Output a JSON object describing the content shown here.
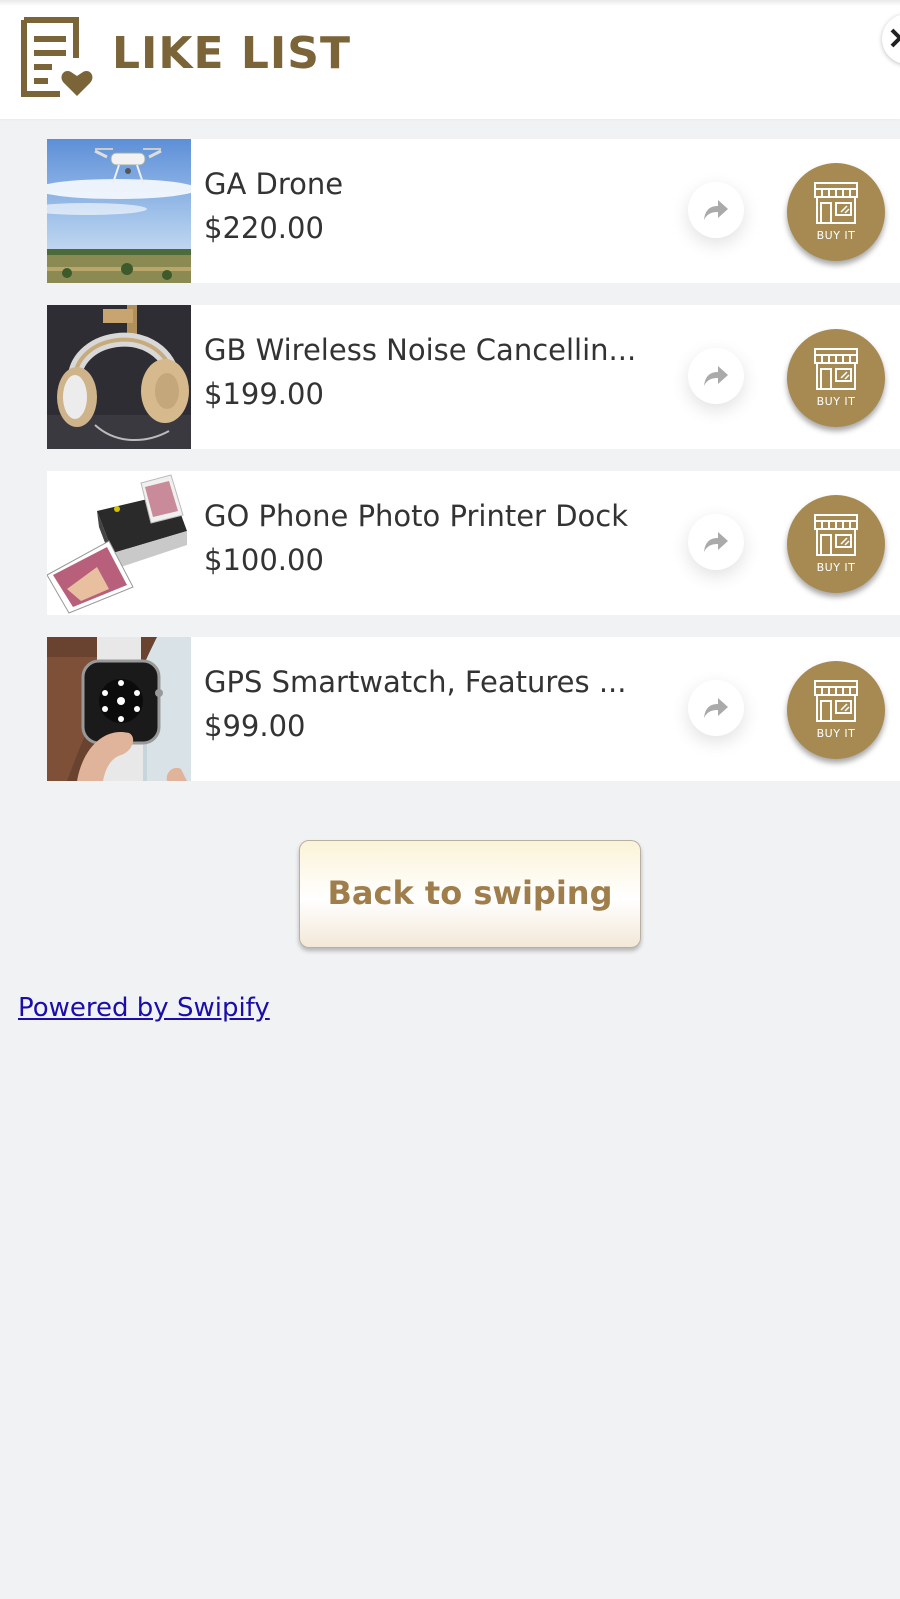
{
  "header": {
    "title": "LIKE LIST",
    "logo_icon": "list-heart-icon",
    "close_icon": "close-icon",
    "brand_color": "#7a6438"
  },
  "items": [
    {
      "name": "GA Drone",
      "price": "$220.00",
      "image": "drone-photo",
      "buy_label": "BUY IT"
    },
    {
      "name": "GB Wireless Noise Cancellin...",
      "price": "$199.00",
      "image": "headphones-photo",
      "buy_label": "BUY IT"
    },
    {
      "name": "GO Phone Photo Printer Dock",
      "price": "$100.00",
      "image": "photo-printer-photo",
      "buy_label": "BUY IT"
    },
    {
      "name": "GPS Smartwatch, Features ...",
      "price": "$99.00",
      "image": "smartwatch-photo",
      "buy_label": "BUY IT"
    }
  ],
  "share_icon": "share-arrow-icon",
  "buy_icon": "storefront-icon",
  "buy_color": "#a68a52",
  "back_button": {
    "label": "Back to swiping"
  },
  "footer": {
    "powered_by": "Powered by Swipify",
    "link_color": "#1a0dab"
  }
}
